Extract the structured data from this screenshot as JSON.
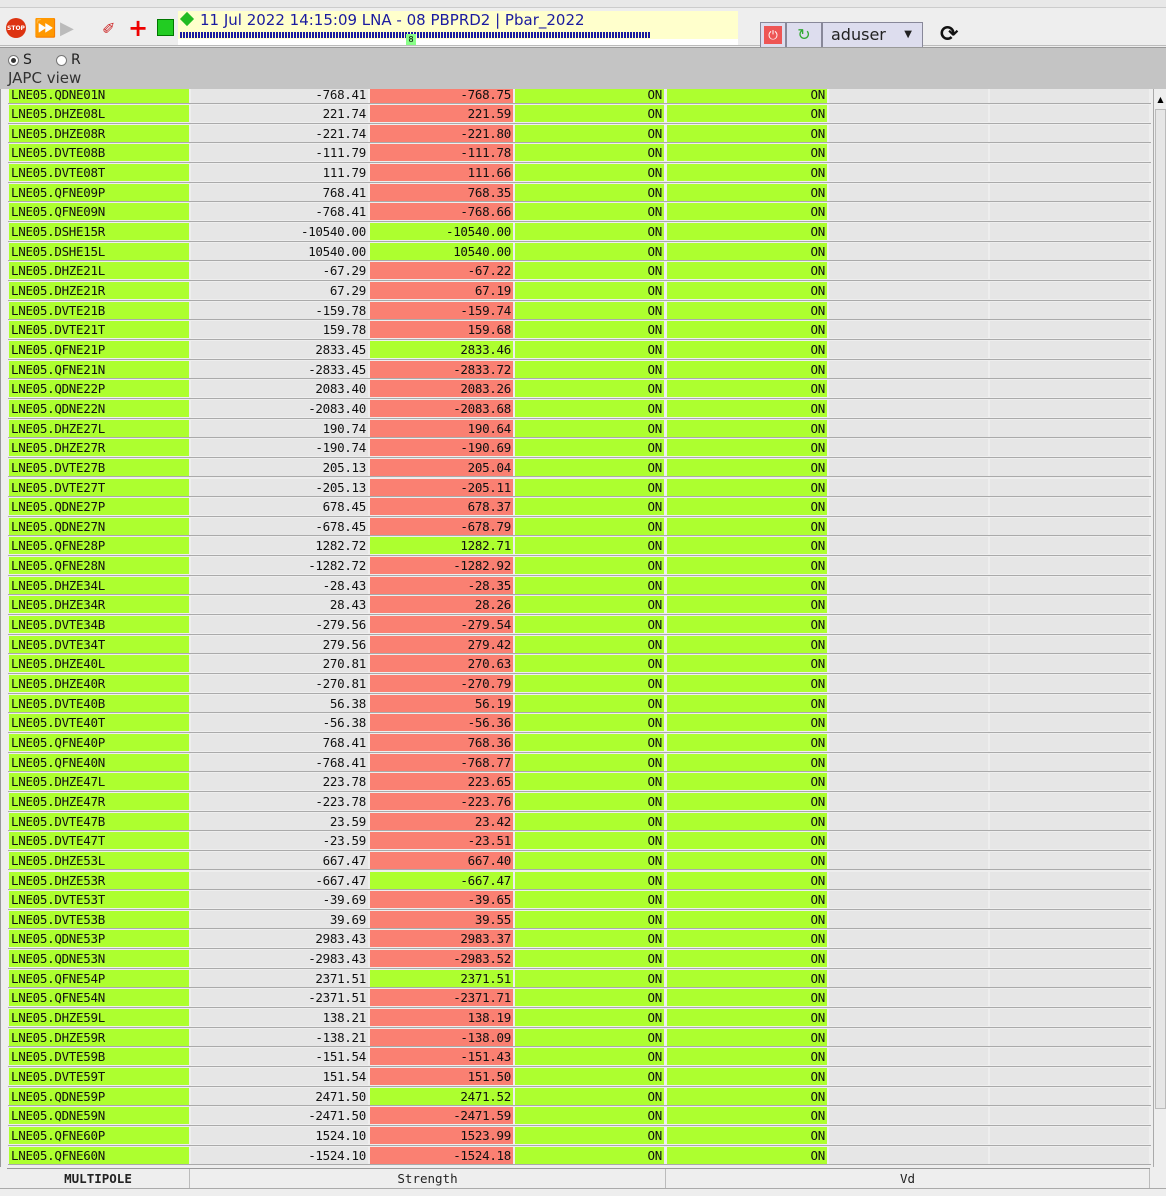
{
  "toolbar": {
    "stop_label": "STOP",
    "info_title": "11 Jul 2022  14:15:09  LNA - 08 PBPRD2 | Pbar_2022",
    "cycle_marker": "8",
    "user": "aduser"
  },
  "panel": {
    "radio_s": "S",
    "radio_r": "R",
    "radio_selected": "S",
    "view_title": "JAPC view"
  },
  "table": {
    "footer": [
      "MULTIPOLE",
      "Strength",
      "Vd"
    ],
    "rows": [
      [
        "LNE05.QDNE01N",
        "-768.41",
        "-768.75",
        "red",
        "ON",
        "ON"
      ],
      [
        "LNE05.DHZE08L",
        "221.74",
        "221.59",
        "red",
        "ON",
        "ON"
      ],
      [
        "LNE05.DHZE08R",
        "-221.74",
        "-221.80",
        "red",
        "ON",
        "ON"
      ],
      [
        "LNE05.DVTE08B",
        "-111.79",
        "-111.78",
        "red",
        "ON",
        "ON"
      ],
      [
        "LNE05.DVTE08T",
        "111.79",
        "111.66",
        "red",
        "ON",
        "ON"
      ],
      [
        "LNE05.QFNE09P",
        "768.41",
        "768.35",
        "red",
        "ON",
        "ON"
      ],
      [
        "LNE05.QFNE09N",
        "-768.41",
        "-768.66",
        "red",
        "ON",
        "ON"
      ],
      [
        "LNE05.DSHE15R",
        "-10540.00",
        "-10540.00",
        "green",
        "ON",
        "ON"
      ],
      [
        "LNE05.DSHE15L",
        "10540.00",
        "10540.00",
        "green",
        "ON",
        "ON"
      ],
      [
        "LNE05.DHZE21L",
        "-67.29",
        "-67.22",
        "red",
        "ON",
        "ON"
      ],
      [
        "LNE05.DHZE21R",
        "67.29",
        "67.19",
        "red",
        "ON",
        "ON"
      ],
      [
        "LNE05.DVTE21B",
        "-159.78",
        "-159.74",
        "red",
        "ON",
        "ON"
      ],
      [
        "LNE05.DVTE21T",
        "159.78",
        "159.68",
        "red",
        "ON",
        "ON"
      ],
      [
        "LNE05.QFNE21P",
        "2833.45",
        "2833.46",
        "green",
        "ON",
        "ON"
      ],
      [
        "LNE05.QFNE21N",
        "-2833.45",
        "-2833.72",
        "red",
        "ON",
        "ON"
      ],
      [
        "LNE05.QDNE22P",
        "2083.40",
        "2083.26",
        "red",
        "ON",
        "ON"
      ],
      [
        "LNE05.QDNE22N",
        "-2083.40",
        "-2083.68",
        "red",
        "ON",
        "ON"
      ],
      [
        "LNE05.DHZE27L",
        "190.74",
        "190.64",
        "red",
        "ON",
        "ON"
      ],
      [
        "LNE05.DHZE27R",
        "-190.74",
        "-190.69",
        "red",
        "ON",
        "ON"
      ],
      [
        "LNE05.DVTE27B",
        "205.13",
        "205.04",
        "red",
        "ON",
        "ON"
      ],
      [
        "LNE05.DVTE27T",
        "-205.13",
        "-205.11",
        "red",
        "ON",
        "ON"
      ],
      [
        "LNE05.QDNE27P",
        "678.45",
        "678.37",
        "red",
        "ON",
        "ON"
      ],
      [
        "LNE05.QDNE27N",
        "-678.45",
        "-678.79",
        "red",
        "ON",
        "ON"
      ],
      [
        "LNE05.QFNE28P",
        "1282.72",
        "1282.71",
        "green",
        "ON",
        "ON"
      ],
      [
        "LNE05.QFNE28N",
        "-1282.72",
        "-1282.92",
        "red",
        "ON",
        "ON"
      ],
      [
        "LNE05.DHZE34L",
        "-28.43",
        "-28.35",
        "red",
        "ON",
        "ON"
      ],
      [
        "LNE05.DHZE34R",
        "28.43",
        "28.26",
        "red",
        "ON",
        "ON"
      ],
      [
        "LNE05.DVTE34B",
        "-279.56",
        "-279.54",
        "red",
        "ON",
        "ON"
      ],
      [
        "LNE05.DVTE34T",
        "279.56",
        "279.42",
        "red",
        "ON",
        "ON"
      ],
      [
        "LNE05.DHZE40L",
        "270.81",
        "270.63",
        "red",
        "ON",
        "ON"
      ],
      [
        "LNE05.DHZE40R",
        "-270.81",
        "-270.79",
        "red",
        "ON",
        "ON"
      ],
      [
        "LNE05.DVTE40B",
        "56.38",
        "56.19",
        "red",
        "ON",
        "ON"
      ],
      [
        "LNE05.DVTE40T",
        "-56.38",
        "-56.36",
        "red",
        "ON",
        "ON"
      ],
      [
        "LNE05.QFNE40P",
        "768.41",
        "768.36",
        "red",
        "ON",
        "ON"
      ],
      [
        "LNE05.QFNE40N",
        "-768.41",
        "-768.77",
        "red",
        "ON",
        "ON"
      ],
      [
        "LNE05.DHZE47L",
        "223.78",
        "223.65",
        "red",
        "ON",
        "ON"
      ],
      [
        "LNE05.DHZE47R",
        "-223.78",
        "-223.76",
        "red",
        "ON",
        "ON"
      ],
      [
        "LNE05.DVTE47B",
        "23.59",
        "23.42",
        "red",
        "ON",
        "ON"
      ],
      [
        "LNE05.DVTE47T",
        "-23.59",
        "-23.51",
        "red",
        "ON",
        "ON"
      ],
      [
        "LNE05.DHZE53L",
        "667.47",
        "667.40",
        "red",
        "ON",
        "ON"
      ],
      [
        "LNE05.DHZE53R",
        "-667.47",
        "-667.47",
        "green",
        "ON",
        "ON"
      ],
      [
        "LNE05.DVTE53T",
        "-39.69",
        "-39.65",
        "red",
        "ON",
        "ON"
      ],
      [
        "LNE05.DVTE53B",
        "39.69",
        "39.55",
        "red",
        "ON",
        "ON"
      ],
      [
        "LNE05.QDNE53P",
        "2983.43",
        "2983.37",
        "red",
        "ON",
        "ON"
      ],
      [
        "LNE05.QDNE53N",
        "-2983.43",
        "-2983.52",
        "red",
        "ON",
        "ON"
      ],
      [
        "LNE05.QFNE54P",
        "2371.51",
        "2371.51",
        "green",
        "ON",
        "ON"
      ],
      [
        "LNE05.QFNE54N",
        "-2371.51",
        "-2371.71",
        "red",
        "ON",
        "ON"
      ],
      [
        "LNE05.DHZE59L",
        "138.21",
        "138.19",
        "red",
        "ON",
        "ON"
      ],
      [
        "LNE05.DHZE59R",
        "-138.21",
        "-138.09",
        "red",
        "ON",
        "ON"
      ],
      [
        "LNE05.DVTE59B",
        "-151.54",
        "-151.43",
        "red",
        "ON",
        "ON"
      ],
      [
        "LNE05.DVTE59T",
        "151.54",
        "151.50",
        "red",
        "ON",
        "ON"
      ],
      [
        "LNE05.QDNE59P",
        "2471.50",
        "2471.52",
        "green",
        "ON",
        "ON"
      ],
      [
        "LNE05.QDNE59N",
        "-2471.50",
        "-2471.59",
        "red",
        "ON",
        "ON"
      ],
      [
        "LNE05.QFNE60P",
        "1524.10",
        "1523.99",
        "red",
        "ON",
        "ON"
      ],
      [
        "LNE05.QFNE60N",
        "-1524.10",
        "-1524.18",
        "red",
        "ON",
        "ON"
      ]
    ]
  },
  "colors": {
    "ok": "#adff2f",
    "mismatch": "#fa8072"
  }
}
